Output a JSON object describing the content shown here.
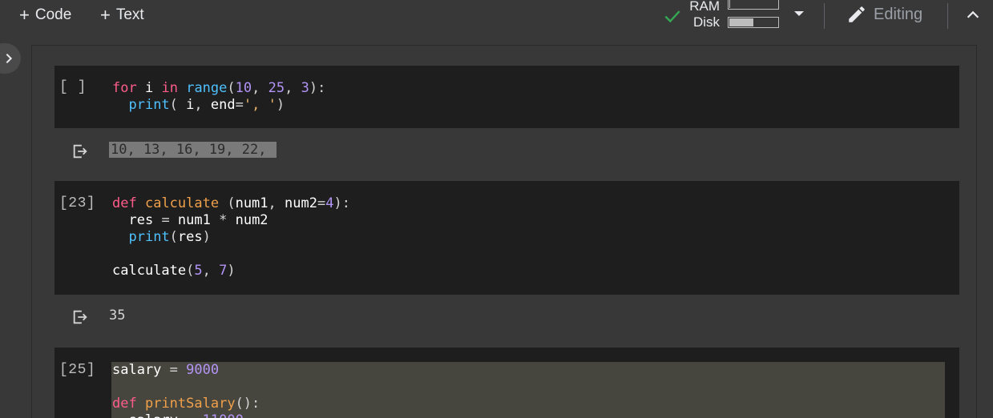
{
  "toolbar": {
    "add_code_label": "Code",
    "add_text_label": "Text",
    "ram_label": "RAM",
    "disk_label": "Disk",
    "ram_fraction": 0.02,
    "disk_fraction": 0.5,
    "editing_label": "Editing"
  },
  "cells": [
    {
      "exec_count": "[ ]",
      "output": "10, 13, 16, 19, 22, "
    },
    {
      "exec_count": "[23]",
      "output": "35"
    },
    {
      "exec_count": "[25]"
    }
  ],
  "colors": {
    "cell_background": "#1e1e1e",
    "keyword": "#ff5c8a",
    "number": "#b294f5",
    "function_def": "#f0a04b",
    "builtin": "#4fc1ff",
    "check": "#34a853"
  },
  "icons": [
    "plus-icon",
    "check-icon",
    "chevron-down-icon",
    "pencil-icon",
    "chevron-up-icon",
    "chevron-right-icon",
    "output-icon"
  ]
}
